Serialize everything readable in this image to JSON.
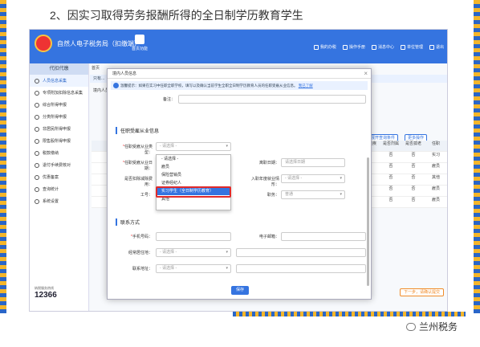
{
  "heading": "2、因实习取得劳务报酬所得的全日制学历教育学生",
  "app": {
    "title": "自然人电子税务局（扣缴端）",
    "home_label": "首页功能",
    "top_menu": [
      "我的办税",
      "操作手册",
      "消息中心",
      "单位管理",
      "退出"
    ]
  },
  "sidebar": {
    "caption": "代扣代缴",
    "items": [
      "人员信息采集",
      "专项附加扣除信息采集",
      "综合所得申报",
      "分类所得申报",
      "非居民所得申报",
      "限售股所得申报",
      "税款缴纳",
      "退付手续费核对",
      "优惠备案",
      "查询统计",
      "系统设置"
    ],
    "hotline": "12366",
    "hotline_caption": "纳税服务热线"
  },
  "main": {
    "crumb": "首页",
    "notice": "只有...",
    "add_label": "境内人员",
    "buttons": [
      "展开查询条件",
      "更多操作"
    ],
    "cols": [
      "是否残疾",
      "是否烈属",
      "是否孤老",
      "任职"
    ],
    "rows": [
      [
        "否",
        "否",
        "否",
        "实习"
      ],
      [
        "否",
        "否",
        "否",
        "雇员"
      ],
      [
        "否",
        "否",
        "否",
        "其他"
      ],
      [
        "否",
        "否",
        "否",
        "雇员"
      ],
      [
        "否",
        "否",
        "否",
        "雇员"
      ]
    ],
    "next_btn": "下一步，请确认提交"
  },
  "dialog": {
    "title": "境内人员信息",
    "close": "×",
    "warning": "温馨提示：如果在实习中任职全职学校，填写以及确认当前学生全职全日制学历教育人员的任职受雇从业信息。",
    "warning_link": "我已了解",
    "remark_label": "备注：",
    "section1": "任职受雇从业信息",
    "employment_type_label": "任职受雇从业类型：",
    "employment_type_value": "- 请选择 -",
    "hire_date_label": "任职受雇从业日期：",
    "leave_date_label": "离职日期：",
    "leave_date_value": "请选择日期",
    "reason_label": "是否扣除减除费用：",
    "entry_date_label": "入职年度就业情形：",
    "entry_date_value": "- 请选择 -",
    "job_label": "工号：",
    "title_label": "职务：",
    "title_value": "普通",
    "options": [
      "- 请选择 -",
      "雇员",
      "保险营销员",
      "证券经纪人",
      "实习学生（全日制学历教育）",
      "其他"
    ],
    "section2": "联系方式",
    "phone_label": "手机号码：",
    "email_label": "电子邮箱：",
    "region_label": "经常居住地：",
    "region_value": "- 请选择 -",
    "contact_label": "联系地址：",
    "contact_value": "- 请选择 -",
    "save": "保存"
  },
  "watermark": "兰州税务"
}
